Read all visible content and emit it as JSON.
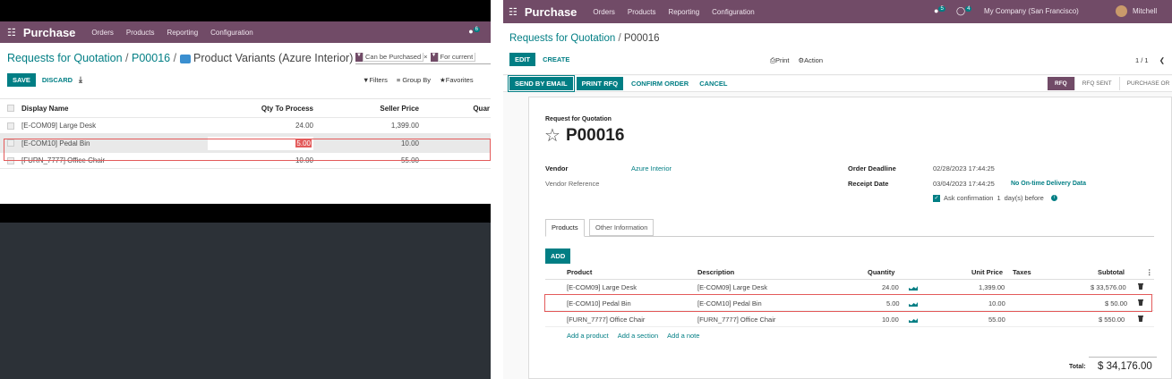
{
  "left_window": {
    "nav": {
      "app_name": "Purchase",
      "menu": [
        "Orders",
        "Products",
        "Reporting",
        "Configuration"
      ],
      "chat_count": "6"
    },
    "breadcrumb": {
      "part1": "Requests for Quotation",
      "sep1": "/",
      "part2": "P00016",
      "sep2": "/",
      "part3": "Product Variants (Azure Interior)"
    },
    "search": {
      "facet1": "Can be Purchased",
      "facet1_close": "×",
      "facet2": "For current"
    },
    "buttons": {
      "save": "SAVE",
      "discard": "DISCARD"
    },
    "search_tools": {
      "filters": "Filters",
      "group_by": "Group By",
      "favorites": "Favorites"
    },
    "table": {
      "headers": {
        "name": "Display Name",
        "qty": "Qty To Process",
        "price": "Seller Price",
        "quantity": "Quar"
      },
      "rows": [
        {
          "name": "[E-COM09] Large Desk",
          "qty": "24.00",
          "price": "1,399.00"
        },
        {
          "name": "[E-COM10] Pedal Bin",
          "qty": "5.00",
          "price": "10.00"
        },
        {
          "name": "[FURN_7777] Office Chair",
          "qty": "10.00",
          "price": "55.00"
        }
      ]
    }
  },
  "right_window": {
    "nav": {
      "app_name": "Purchase",
      "menu": [
        "Orders",
        "Products",
        "Reporting",
        "Configuration"
      ],
      "chat_count": "5",
      "activity_count": "4",
      "company": "My Company (San Francisco)",
      "user": "Mitchell"
    },
    "breadcrumb": {
      "part1": "Requests for Quotation",
      "sep": "/",
      "part2": "P00016"
    },
    "control": {
      "edit": "EDIT",
      "create": "CREATE",
      "print": "Print",
      "action": "Action",
      "pager": "1 / 1"
    },
    "status_buttons": {
      "send_email": "SEND BY EMAIL",
      "print_rfq": "PRINT RFQ",
      "confirm": "CONFIRM ORDER",
      "cancel": "CANCEL"
    },
    "status_steps": [
      "RFQ",
      "RFQ SENT",
      "PURCHASE OR"
    ],
    "form": {
      "doc_type": "Request for Quotation",
      "name": "P00016",
      "vendor_label": "Vendor",
      "vendor_value": "Azure Interior",
      "vendor_ref_label": "Vendor Reference",
      "deadline_label": "Order Deadline",
      "deadline_value": "02/28/2023 17:44:25",
      "receipt_label": "Receipt Date",
      "receipt_value": "03/04/2023 17:44:25",
      "receipt_note": "No On-time Delivery Data",
      "ask_confirm_prefix": "Ask confirmation",
      "ask_confirm_days": "1",
      "ask_confirm_suffix": "day(s) before"
    },
    "tabs": [
      "Products",
      "Other Information"
    ],
    "lines": {
      "add": "ADD",
      "headers": {
        "product": "Product",
        "description": "Description",
        "quantity": "Quantity",
        "unit_price": "Unit Price",
        "taxes": "Taxes",
        "subtotal": "Subtotal"
      },
      "rows": [
        {
          "product": "[E-COM09] Large Desk",
          "description": "[E-COM09] Large Desk",
          "quantity": "24.00",
          "unit_price": "1,399.00",
          "subtotal": "$ 33,576.00"
        },
        {
          "product": "[E-COM10] Pedal Bin",
          "description": "[E-COM10] Pedal Bin",
          "quantity": "5.00",
          "unit_price": "10.00",
          "subtotal": "$ 50.00"
        },
        {
          "product": "[FURN_7777] Office Chair",
          "description": "[FURN_7777] Office Chair",
          "quantity": "10.00",
          "unit_price": "55.00",
          "subtotal": "$ 550.00"
        }
      ],
      "add_product": "Add a product",
      "add_section": "Add a section",
      "add_note": "Add a note"
    },
    "total": {
      "label": "Total:",
      "value": "$ 34,176.00"
    }
  },
  "colors": {
    "nav_purple": "#714b67",
    "teal": "#017e84",
    "highlight_red": "#e35a5a",
    "dark_bg": "#2c3137"
  }
}
